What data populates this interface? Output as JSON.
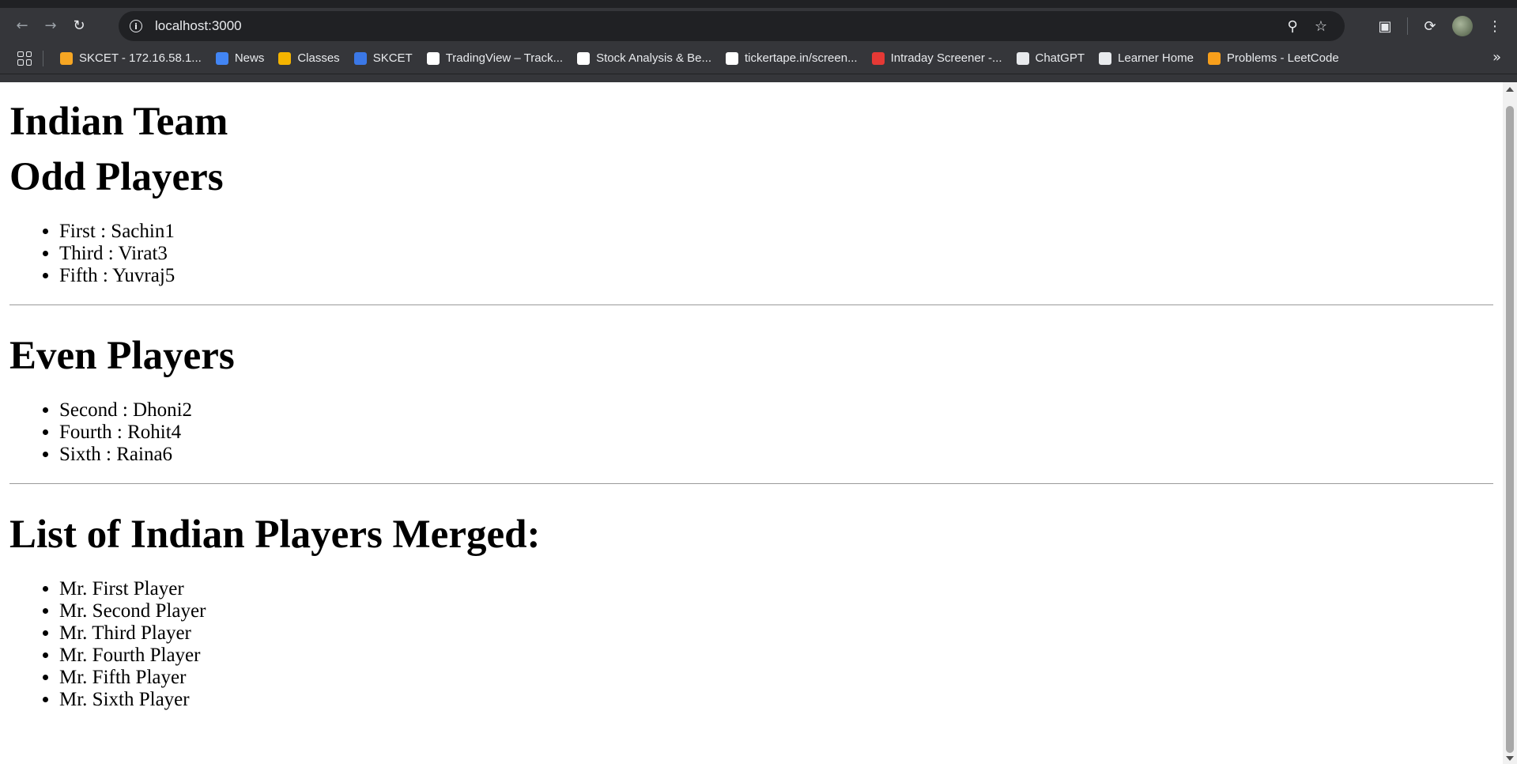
{
  "browser": {
    "url": "localhost:3000",
    "bookmarks": [
      {
        "label": "SKCET - 172.16.58.1...",
        "icon": "skcet-mail-icon",
        "color": "#f6a623"
      },
      {
        "label": "News",
        "icon": "google-news-icon",
        "color": "#4285f4"
      },
      {
        "label": "Classes",
        "icon": "google-classroom-icon",
        "color": "#f4b400"
      },
      {
        "label": "SKCET",
        "icon": "skcet-icon",
        "color": "#3b78e7"
      },
      {
        "label": "TradingView – Track...",
        "icon": "tradingview-icon",
        "color": "#ffffff"
      },
      {
        "label": "Stock Analysis & Be...",
        "icon": "tickertape-icon",
        "color": "#ffffff"
      },
      {
        "label": "tickertape.in/screen...",
        "icon": "tickertape-icon",
        "color": "#ffffff"
      },
      {
        "label": "Intraday Screener -...",
        "icon": "screener-icon",
        "color": "#e53935"
      },
      {
        "label": "ChatGPT",
        "icon": "chatgpt-icon",
        "color": "#e8eaed"
      },
      {
        "label": "Learner Home",
        "icon": "edx-icon",
        "color": "#e8eaed"
      },
      {
        "label": "Problems - LeetCode",
        "icon": "leetcode-icon",
        "color": "#f89f1b"
      }
    ]
  },
  "page": {
    "title": "Indian Team",
    "odd_heading": "Odd Players",
    "odd_players": [
      "First : Sachin1",
      "Third : Virat3",
      "Fifth : Yuvraj5"
    ],
    "even_heading": "Even Players",
    "even_players": [
      "Second : Dhoni2",
      "Fourth : Rohit4",
      "Sixth : Raina6"
    ],
    "merged_heading": "List of Indian Players Merged:",
    "merged_players": [
      "Mr. First Player",
      "Mr. Second Player",
      "Mr. Third Player",
      "Mr. Fourth Player",
      "Mr. Fifth Player",
      "Mr. Sixth Player"
    ]
  }
}
